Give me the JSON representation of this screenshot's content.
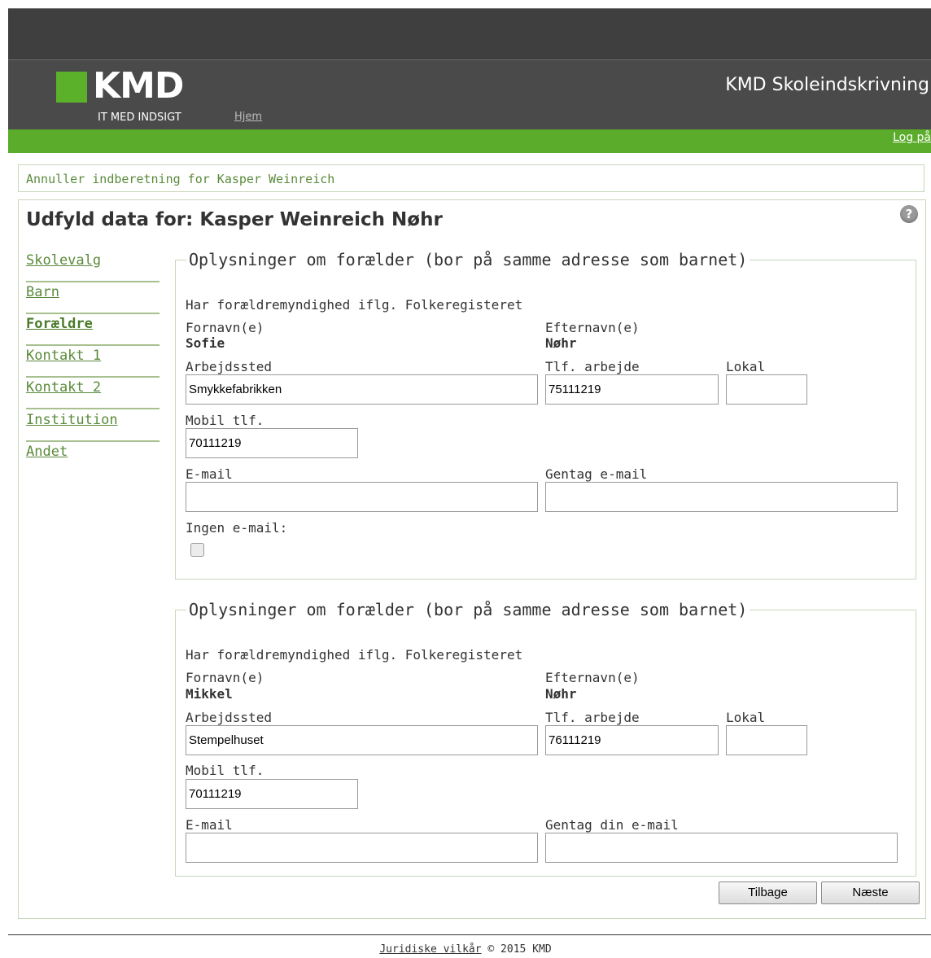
{
  "header": {
    "logo_text": "KMD",
    "tagline": "IT MED INDSIGT",
    "home_link": "Hjem",
    "app_title": "KMD Skoleindskrivning",
    "login_link": "Log på"
  },
  "cancel_link": "Annuller indberetning for Kasper Weinreich",
  "page_title": "Udfyld data for: Kasper Weinreich Nøhr",
  "help_icon": "?",
  "nav": [
    {
      "label": "Skolevalg",
      "active": false
    },
    {
      "label": "Barn",
      "active": false
    },
    {
      "label": "Forældre",
      "active": true
    },
    {
      "label": "Kontakt 1",
      "active": false
    },
    {
      "label": "Kontakt 2",
      "active": false
    },
    {
      "label": "Institution",
      "active": false
    },
    {
      "label": "Andet",
      "active": false
    }
  ],
  "parents": [
    {
      "legend": "Oplysninger om forælder (bor på samme adresse som barnet)",
      "custody_note": "Har forældremyndighed iflg. Folkeregisteret",
      "first_name_label": "Fornavn(e)",
      "first_name": "Sofie",
      "last_name_label": "Efternavn(e)",
      "last_name": "Nøhr",
      "workplace_label": "Arbejdssted",
      "workplace": "Smykkefabrikken",
      "work_phone_label": "Tlf. arbejde",
      "work_phone": "75111219",
      "extension_label": "Lokal",
      "extension": "",
      "mobile_label": "Mobil tlf.",
      "mobile": "70111219",
      "email_label": "E-mail",
      "email": "",
      "repeat_email_label": "Gentag e-mail",
      "repeat_email": "",
      "no_email_label": "Ingen e-mail:",
      "no_email_checked": false
    },
    {
      "legend": "Oplysninger om forælder (bor på samme adresse som barnet)",
      "custody_note": "Har forældremyndighed iflg. Folkeregisteret",
      "first_name_label": "Fornavn(e)",
      "first_name": "Mikkel",
      "last_name_label": "Efternavn(e)",
      "last_name": "Nøhr",
      "workplace_label": "Arbejdssted",
      "workplace": "Stempelhuset",
      "work_phone_label": "Tlf. arbejde",
      "work_phone": "76111219",
      "extension_label": "Lokal",
      "extension": "",
      "mobile_label": "Mobil tlf.",
      "mobile": "70111219",
      "email_label": "E-mail",
      "email": "",
      "repeat_email_label": "Gentag din e-mail",
      "repeat_email": ""
    }
  ],
  "buttons": {
    "back": "Tilbage",
    "next": "Næste"
  },
  "footer": {
    "terms_link": "Juridiske vilkår",
    "copyright": "© 2015 KMD"
  },
  "colors": {
    "brand_green": "#5aac2a",
    "header_dark": "#4a4a4a",
    "link_green": "#5a8a3a"
  }
}
